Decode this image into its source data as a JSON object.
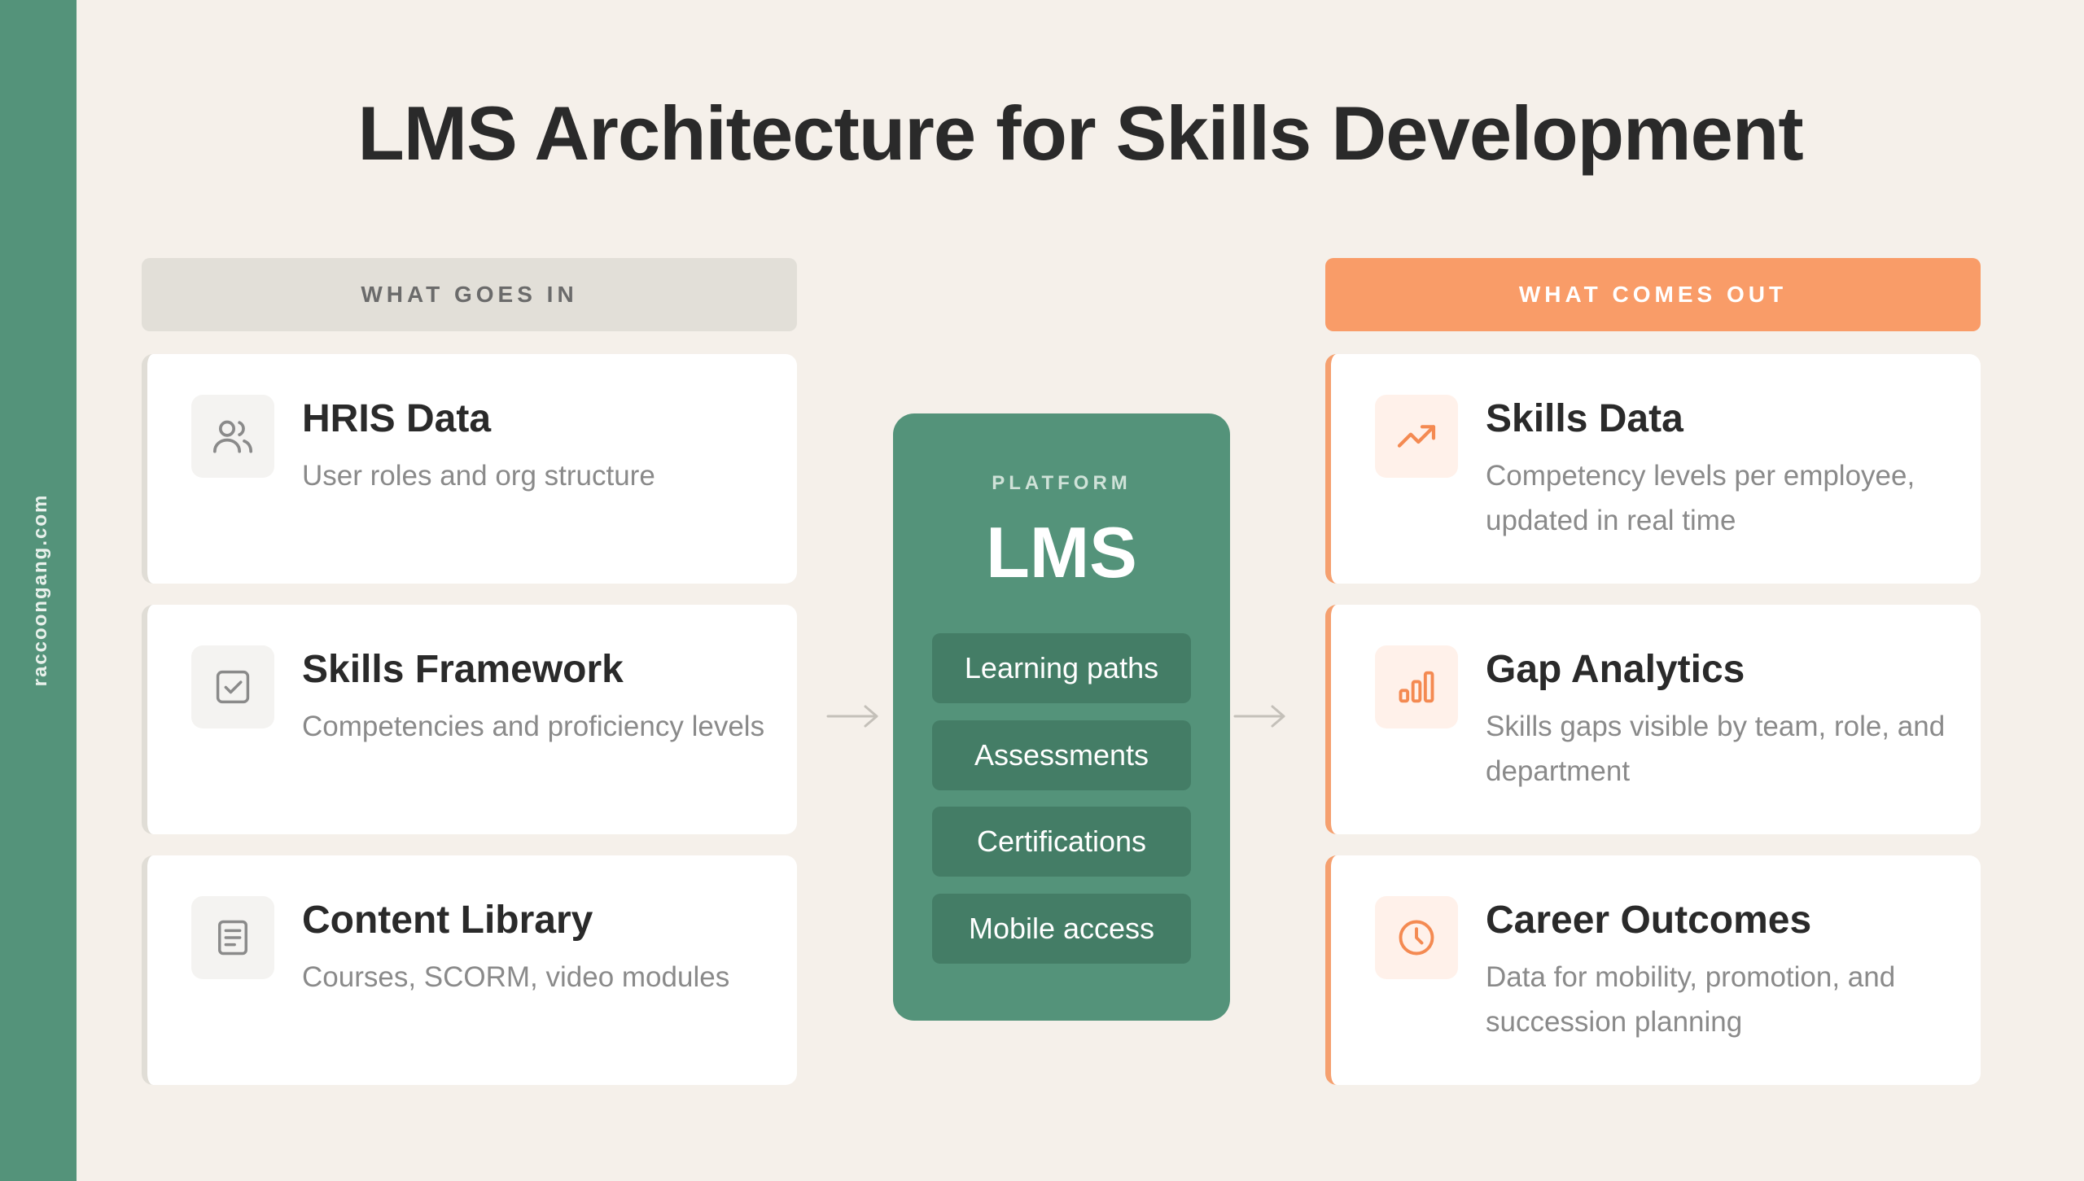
{
  "sidebar": {
    "text": "raccoongang.com",
    "color": "#54937a"
  },
  "title": "LMS Architecture for Skills Development",
  "inputs": {
    "header": "WHAT GOES IN",
    "cards": [
      {
        "title": "HRIS Data",
        "desc": "User roles and org structure",
        "icon": "users-icon"
      },
      {
        "title": "Skills Framework",
        "desc": "Competencies and proficiency levels",
        "icon": "checkbox-icon"
      },
      {
        "title": "Content Library",
        "desc": "Courses, SCORM, video modules",
        "icon": "document-icon"
      }
    ]
  },
  "platform": {
    "eyebrow": "PLATFORM",
    "name": "LMS",
    "features": [
      "Learning paths",
      "Assessments",
      "Certifications",
      "Mobile access"
    ]
  },
  "outputs": {
    "header": "WHAT COMES OUT",
    "cards": [
      {
        "title": "Skills Data",
        "desc": "Competency levels per employee, updated in real time",
        "icon": "trend-up-icon"
      },
      {
        "title": "Gap Analytics",
        "desc": "Skills gaps visible by team, role, and department",
        "icon": "bar-chart-icon"
      },
      {
        "title": "Career Outcomes",
        "desc": "Data for mobility, promotion, and succession planning",
        "icon": "clock-icon"
      }
    ]
  },
  "colors": {
    "background": "#f5f0ea",
    "green": "#54937a",
    "orange": "#f99c68",
    "gray_header": "#e2dfd8"
  }
}
